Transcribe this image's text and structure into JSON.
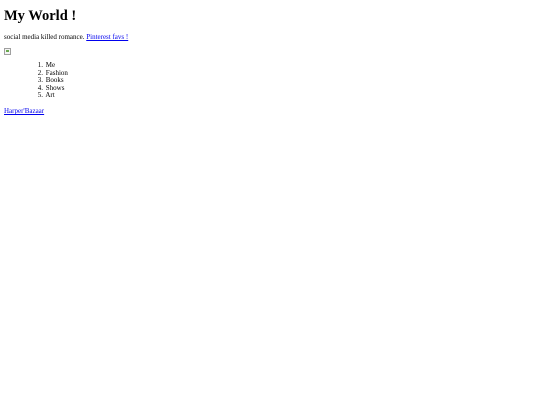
{
  "header": {
    "title": "My World !"
  },
  "tagline": {
    "text": "social media killed romance.",
    "link_label": "Pinterest favs !"
  },
  "nav": {
    "items": [
      {
        "num": "1.",
        "label": "Me"
      },
      {
        "num": "2.",
        "label": "Fashion"
      },
      {
        "num": "3.",
        "label": "Books"
      },
      {
        "num": "4.",
        "label": "Shows"
      },
      {
        "num": "5.",
        "label": "Art"
      }
    ]
  },
  "footer": {
    "link_label": "Harper'Bazaar"
  },
  "colors": {
    "link": "#0000ee",
    "text": "#000000",
    "background": "#ffffff"
  },
  "icons": {
    "image_placeholder": "broken-image-icon"
  }
}
